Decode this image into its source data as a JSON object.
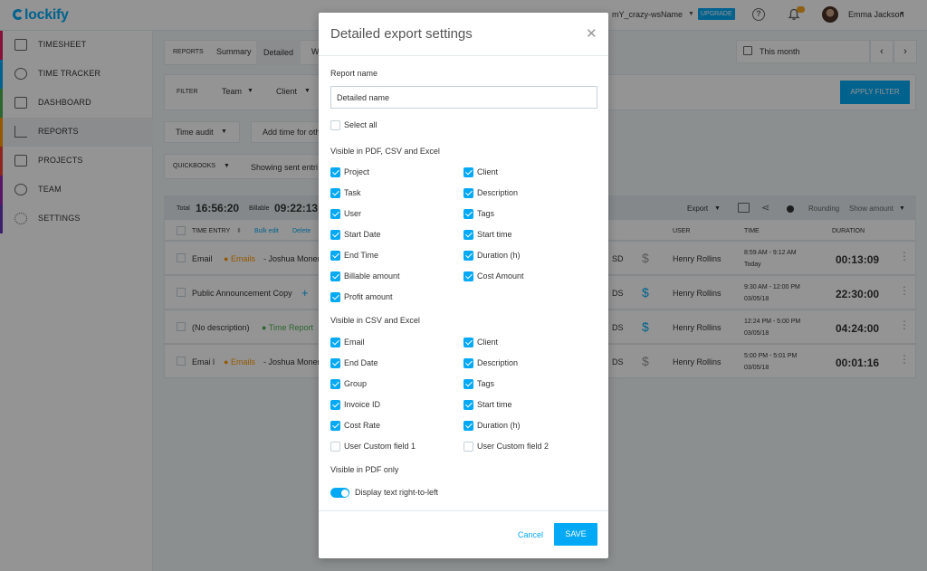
{
  "app": {
    "logo": "lockify",
    "workspace": "mY_crazy-wsName",
    "upgrade_label": "UPGRADE",
    "user_name": "Emma Jackson"
  },
  "sidebar": {
    "items": [
      {
        "label": "TIMESHEET",
        "color": "#e91e63"
      },
      {
        "label": "TIME TRACKER",
        "color": "#03a9f4"
      },
      {
        "label": "DASHBOARD",
        "color": "#4caf50"
      },
      {
        "label": "REPORTS",
        "color": "#ff9800",
        "active": true
      },
      {
        "label": "PROJECTS",
        "color": "#f44336"
      },
      {
        "label": "TEAM",
        "color": "#9c27b0"
      },
      {
        "label": "SETTINGS",
        "color": "#673ab7"
      }
    ]
  },
  "background": {
    "reports_label": "REPORTS",
    "tab_summary": "Summary",
    "tab_detailed": "Detailed",
    "tab_weekly": "W",
    "date_range": "This month",
    "filter_label": "FILTER",
    "filter_team": "Team",
    "filter_client": "Client",
    "apply_filter": "APPLY FILTER",
    "time_audit": "Time audit",
    "add_time": "Add time for oth",
    "quickbooks": "QUICKBOOKS",
    "showing_sent": "Showing sent entri",
    "total_label": "Total",
    "total_value": "16:56:20",
    "billable_label": "Billable",
    "billable_value": "09:22:13",
    "export_label": "Export",
    "rounding_label": "Rounding",
    "show_amount": "Show amount",
    "col_time_entry": "TIME ENTRY",
    "bulk_edit": "Bulk edit",
    "delete_label": "Delete",
    "col_user": "USER",
    "col_time": "TIME",
    "col_duration": "DURATION",
    "rows": [
      {
        "desc": "Email",
        "project": "Emails",
        "client": "- Joshua Monen",
        "project_color": "#ff9800",
        "amount": "SD",
        "user": "Henry Rollins",
        "time": "8:59 AM - 9:12 AM",
        "date": "Today",
        "duration": "00:13:09"
      },
      {
        "desc": "Public Announcement Copy",
        "project": "",
        "client": "",
        "project_color": "#03a9f4",
        "amount": "DS",
        "user": "Henry Rollins",
        "time": "9:30 AM - 12:00 PM",
        "date": "03/05/18",
        "duration": "22:30:00"
      },
      {
        "desc": "(No description)",
        "project": "Time Report",
        "client": "",
        "project_color": "#4caf50",
        "amount": "DS",
        "user": "Henry Rollins",
        "time": "12:24 PM - 5:00 PM",
        "date": "03/05/18",
        "duration": "04:24:00"
      },
      {
        "desc": "Emai l",
        "project": "Emails",
        "client": "- Joshua Monen",
        "project_color": "#ff9800",
        "amount": "DS",
        "user": "Henry Rollins",
        "time": "5:00 PM - 5:01 PM",
        "date": "03/05/18",
        "duration": "00:01:16"
      }
    ]
  },
  "modal": {
    "title": "Detailed export settings",
    "report_name_label": "Report name",
    "report_name_value": "Detailed name",
    "select_all_label": "Select all",
    "section_pdf_csv_excel": "Visible in PDF, CSV and Excel",
    "pdf_csv_excel_fields": [
      {
        "label": "Project",
        "checked": true
      },
      {
        "label": "Client",
        "checked": true
      },
      {
        "label": "Task",
        "checked": true
      },
      {
        "label": "Description",
        "checked": true
      },
      {
        "label": "User",
        "checked": true
      },
      {
        "label": "Tags",
        "checked": true
      },
      {
        "label": "Start Date",
        "checked": true
      },
      {
        "label": "Start time",
        "checked": true
      },
      {
        "label": "End Time",
        "checked": true
      },
      {
        "label": "Duration (h)",
        "checked": true
      },
      {
        "label": "Billable amount",
        "checked": true
      },
      {
        "label": "Cost Amount",
        "checked": true
      },
      {
        "label": "Profit amount",
        "checked": true
      }
    ],
    "section_csv_excel": "Visible in CSV and Excel",
    "csv_excel_fields": [
      {
        "label": "Email",
        "checked": true
      },
      {
        "label": "Client",
        "checked": true
      },
      {
        "label": "End Date",
        "checked": true
      },
      {
        "label": "Description",
        "checked": true
      },
      {
        "label": "Group",
        "checked": true
      },
      {
        "label": "Tags",
        "checked": true
      },
      {
        "label": "Invoice ID",
        "checked": true
      },
      {
        "label": "Start time",
        "checked": true
      },
      {
        "label": "Cost Rate",
        "checked": true
      },
      {
        "label": "Duration (h)",
        "checked": true
      },
      {
        "label": "User Custom field 1",
        "checked": false
      },
      {
        "label": "User Custom field 2",
        "checked": false
      }
    ],
    "section_pdf_only": "Visible in PDF only",
    "rtl_toggle_label": "Display text right-to-left",
    "rtl_toggle_on": true,
    "cancel_label": "Cancel",
    "save_label": "SAVE"
  }
}
